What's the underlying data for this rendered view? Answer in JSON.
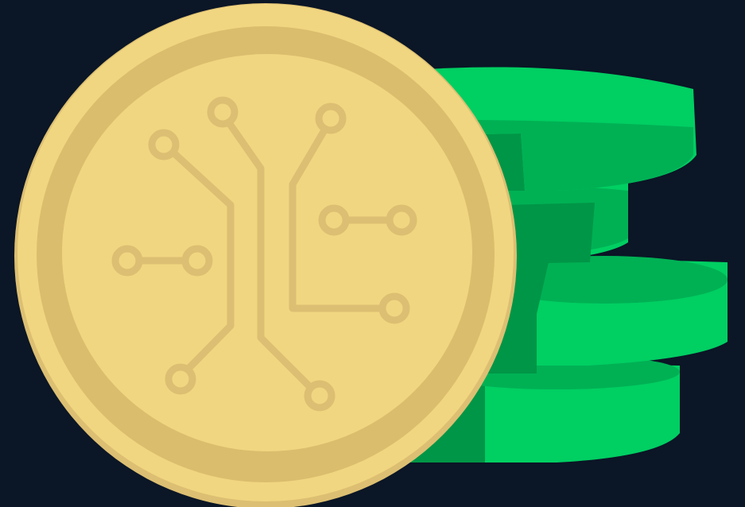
{
  "scene": {
    "subject": "coin-illustration",
    "icon": "circuit-coin-icon"
  },
  "colors": {
    "background": "#0b1626",
    "green_top": "#00cf62",
    "green_mid": "#00b154",
    "green_dark": "#009647",
    "coin_face": "#f1d681",
    "coin_edge": "#dcbf72",
    "coin_rim": "#dbbd6e",
    "circuit_line": "#dcbf72"
  },
  "stack": {
    "coin_count": 4
  }
}
